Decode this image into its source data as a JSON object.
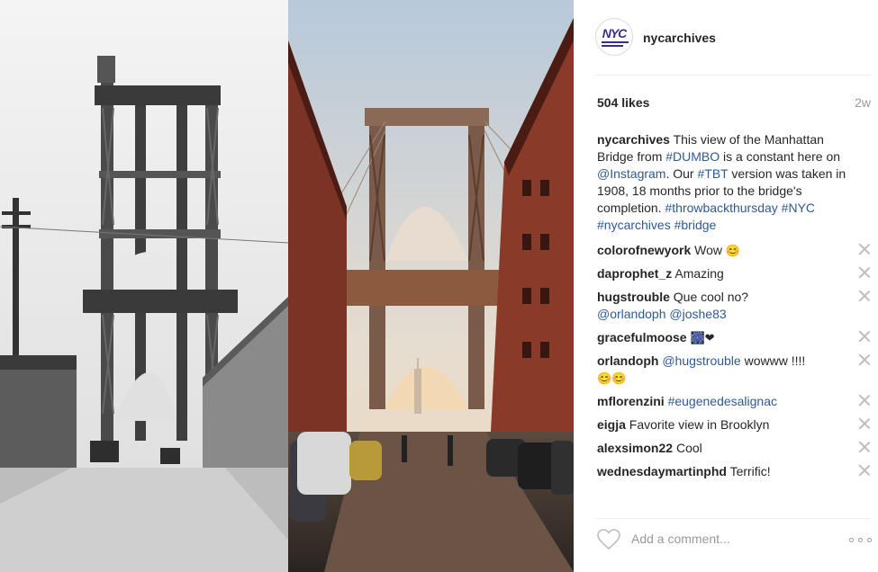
{
  "account": {
    "username": "nycarchives",
    "avatar_logo": "NYC",
    "avatar_icon": "nyc-records-logo-icon"
  },
  "post": {
    "likes": "504 likes",
    "age": "2w",
    "caption": {
      "username": "nycarchives",
      "text_1": " This view of the Manhattan Bridge from ",
      "tag_dumbo": "#DUMBO",
      "text_2": " is a constant here on ",
      "mention_instagram": "@Instagram",
      "text_3": ". Our ",
      "tag_tbt": "#TBT",
      "text_4": " version was taken in 1908, 18 months prior to the bridge's completion. ",
      "tag_throwback": "#throwbackthursday",
      "tag_nyc": "#NYC",
      "tag_nycarchives": "#nycarchives",
      "tag_bridge": "#bridge"
    }
  },
  "comments": [
    {
      "user": "colorofnewyork",
      "text": "Wow ",
      "emoji": "😊"
    },
    {
      "user": "daprophet_z",
      "text": "Amazing"
    },
    {
      "user": "hugstrouble",
      "text": "Que cool no?",
      "mention_1": "@orlandoph",
      "mention_2": "@joshe83"
    },
    {
      "user": "gracefulmoose",
      "emoji": "🎆❤"
    },
    {
      "user": "orlandoph",
      "mention": "@hugstrouble",
      "text": " wowww !!!!",
      "emoji": "😊😊"
    },
    {
      "user": "mflorenzini",
      "mention": "#eugenedesalignac"
    },
    {
      "user": "eigja",
      "text": "Favorite view in Brooklyn"
    },
    {
      "user": "alexsimon22",
      "text": "Cool"
    },
    {
      "user": "wednesdaymartinphd",
      "text": "Terrific!"
    }
  ],
  "footer": {
    "comment_placeholder": "Add a comment...",
    "like_icon": "heart-icon",
    "more_icon": "more-options-icon"
  },
  "colors": {
    "link": "#2e5a92",
    "muted": "#999999",
    "text": "#262626",
    "brand_nyc": "#3d2b92"
  }
}
